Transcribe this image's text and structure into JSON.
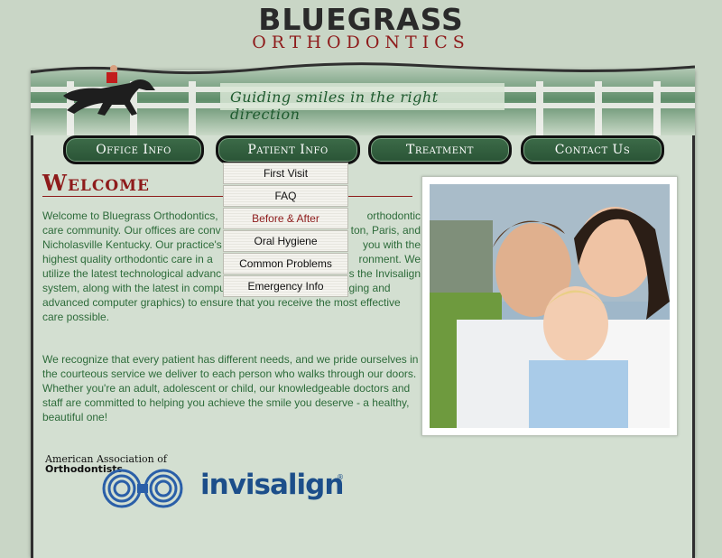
{
  "logo": {
    "name": "BLUEGRASS",
    "subtitle": "ORTHODONTICS"
  },
  "banner": {
    "tagline": "Guiding smiles in the right direction"
  },
  "nav": [
    {
      "label": "Office Info"
    },
    {
      "label": "Patient Info"
    },
    {
      "label": "Treatment"
    },
    {
      "label": "Contact Us"
    }
  ],
  "dropdown": [
    {
      "label": "First Visit"
    },
    {
      "label": "FAQ"
    },
    {
      "label": "Before & After"
    },
    {
      "label": "Oral Hygiene"
    },
    {
      "label": "Common Problems"
    },
    {
      "label": "Emergency Info"
    }
  ],
  "welcome": {
    "title": "Welcome",
    "para1_lines": [
      "Welcome to Bluegrass Orthodontics,",
      "care community. Our offices are conv",
      "Nicholasville Kentucky. Our practice's",
      "highest quality orthodontic care in a",
      "utilize the latest technological advanc",
      "system, along with the latest in computer technology (digital imaging and",
      "advanced computer graphics) to ensure that you receive the most effective",
      "care possible."
    ],
    "para1_right": [
      "orthodontic",
      "ton, Paris, and",
      "you with the",
      "ronment. We",
      "s the Invisalign"
    ],
    "para2": "We recognize that every patient has different needs, and we pride ourselves in the courteous service we deliver to each person who walks through our doors. Whether you're an adult, adolescent or child, our knowledgeable doctors and staff are committed to helping you achieve the smile you deserve - a healthy, beautiful one!"
  },
  "logos": {
    "aao_line1": "American Association of",
    "aao_line2": "Orthodontists",
    "invisalign": "invisalign",
    "invisalign_mark": "®"
  },
  "colors": {
    "brand_red": "#8e1b1b",
    "brand_green": "#2d6b3a",
    "nav_green": "#3c6b48"
  }
}
